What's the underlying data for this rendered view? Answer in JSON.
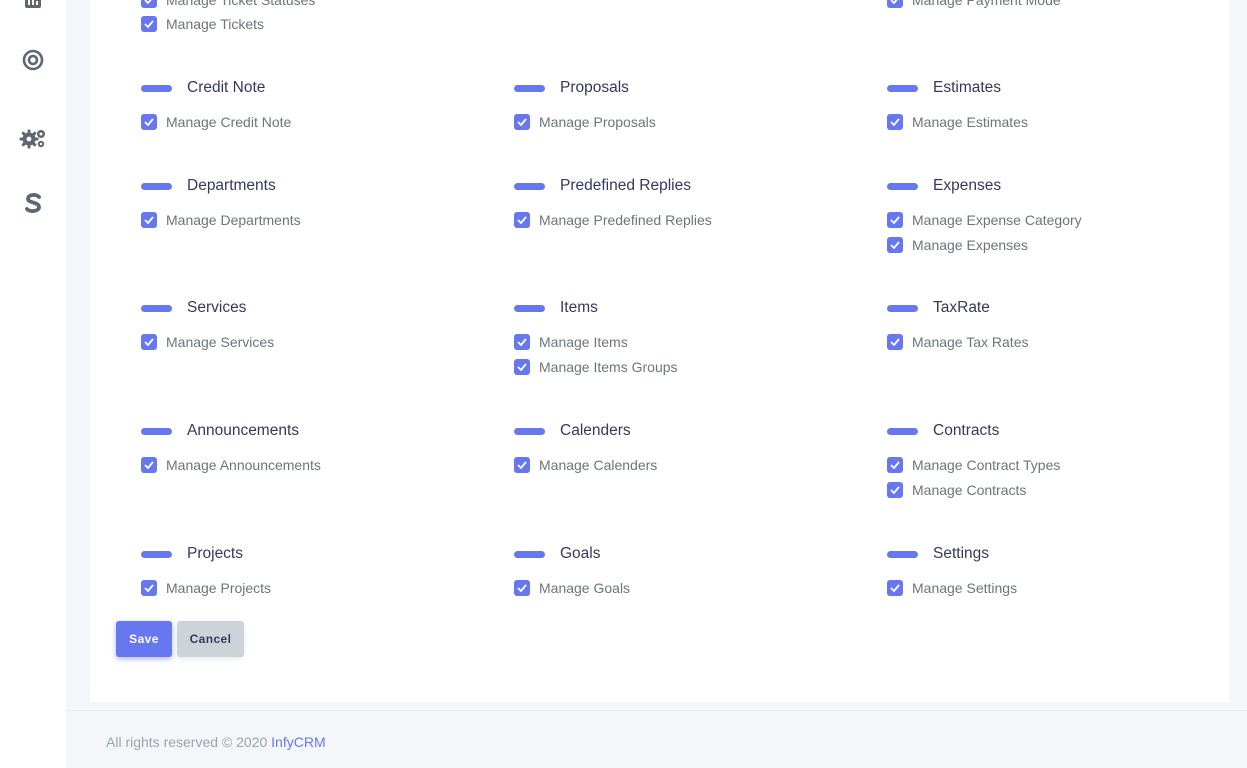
{
  "sidebar": {
    "icons": [
      "chart-icon",
      "target-icon",
      "gears-icon",
      "dollar-s-icon"
    ]
  },
  "top_partial": {
    "col1": [
      "Manage Ticket Statuses",
      "Manage Tickets"
    ],
    "col3": [
      "Manage Payment Mode"
    ]
  },
  "groups": [
    {
      "title": "Credit Note",
      "items": [
        "Manage Credit Note"
      ]
    },
    {
      "title": "Proposals",
      "items": [
        "Manage Proposals"
      ]
    },
    {
      "title": "Estimates",
      "items": [
        "Manage Estimates"
      ]
    },
    {
      "title": "Departments",
      "items": [
        "Manage Departments"
      ]
    },
    {
      "title": "Predefined Replies",
      "items": [
        "Manage Predefined Replies"
      ]
    },
    {
      "title": "Expenses",
      "items": [
        "Manage Expense Category",
        "Manage Expenses"
      ]
    },
    {
      "title": "Services",
      "items": [
        "Manage Services"
      ]
    },
    {
      "title": "Items",
      "items": [
        "Manage Items",
        "Manage Items Groups"
      ]
    },
    {
      "title": "TaxRate",
      "items": [
        "Manage Tax Rates"
      ]
    },
    {
      "title": "Announcements",
      "items": [
        "Manage Announcements"
      ]
    },
    {
      "title": "Calenders",
      "items": [
        "Manage Calenders"
      ]
    },
    {
      "title": "Contracts",
      "items": [
        "Manage Contract Types",
        "Manage Contracts"
      ]
    },
    {
      "title": "Projects",
      "items": [
        "Manage Projects"
      ]
    },
    {
      "title": "Goals",
      "items": [
        "Manage Goals"
      ]
    },
    {
      "title": "Settings",
      "items": [
        "Manage Settings"
      ]
    }
  ],
  "buttons": {
    "save": "Save",
    "cancel": "Cancel"
  },
  "footer": {
    "text": "All rights reserved © 2020",
    "brand": "InfyCRM"
  },
  "colors": {
    "accent": "#6777ef",
    "cancel_bg": "#cdd3d8",
    "text_muted": "#6c757d",
    "heading": "#34395e"
  }
}
